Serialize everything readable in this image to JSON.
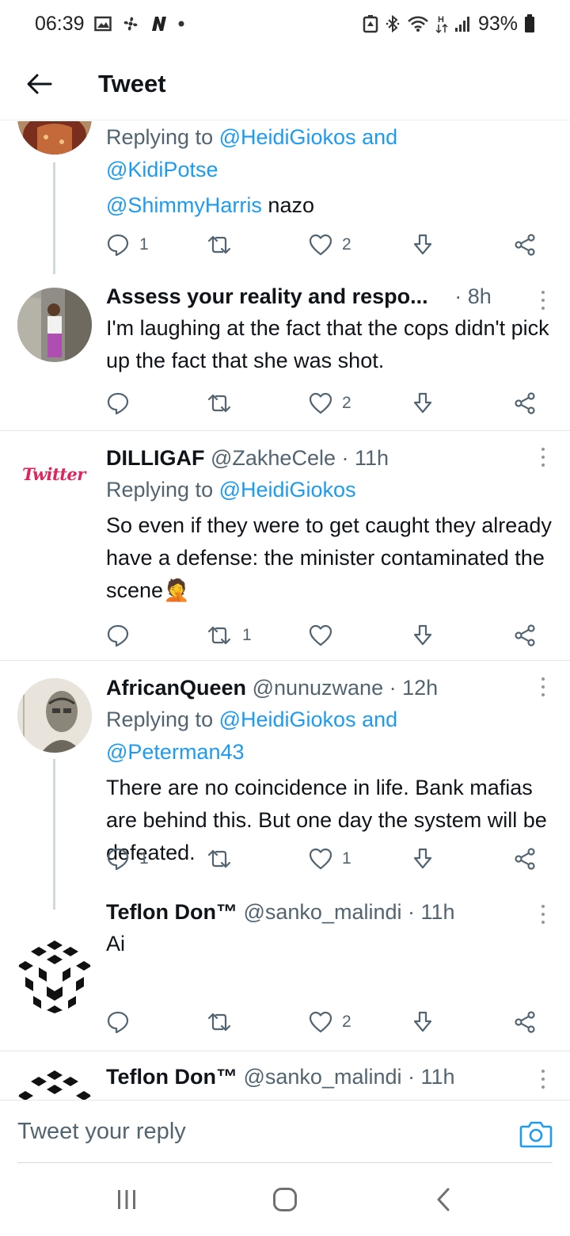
{
  "status_bar": {
    "time": "06:39",
    "battery": "93%",
    "left_icons": [
      "gallery-icon",
      "fan-icon",
      "n-app-icon",
      "dot-icon"
    ],
    "right_icons": [
      "battery-saver-icon",
      "bluetooth-icon",
      "wifi-icon",
      "h-data-icon",
      "signal-icon",
      "battery-icon"
    ]
  },
  "header": {
    "title": "Tweet",
    "back_icon": "arrow-left-icon"
  },
  "tweets": [
    {
      "reply_prefix": "Replying to",
      "reply_mentions": "@HeidiGiokos and @KidiPotse",
      "mention": "@ShimmyHarris",
      "text": " nazo",
      "reply_count": "1",
      "retweet_count": "",
      "like_count": "2"
    },
    {
      "name": "Assess your reality and respo...",
      "time": "· 8h",
      "text": "I'm laughing at the fact that the cops didn't pick up the fact that she was shot.",
      "reply_count": "",
      "retweet_count": "",
      "like_count": "2"
    },
    {
      "name": "DILLIGAF",
      "handle": "@ZakheCele",
      "time": "· 11h",
      "avatar_text": "Twitter",
      "reply_prefix": "Replying to",
      "reply_mentions": "@HeidiGiokos",
      "text": "So even if they were to get caught they already have a defense: the minister contaminated the scene",
      "emoji": "🤦",
      "reply_count": "",
      "retweet_count": "1",
      "like_count": ""
    },
    {
      "name": "AfricanQueen",
      "handle": "@nunuzwane",
      "time": "· 12h",
      "reply_prefix": "Replying to",
      "reply_mentions": "@HeidiGiokos and @Peterman43",
      "text": "There are no coincidence in life. Bank mafias are behind this. But one day the system will be defeated.",
      "reply_count": "1",
      "retweet_count": "",
      "like_count": "1"
    },
    {
      "name": "Teflon Don™",
      "handle": "@sanko_malindi",
      "time": "· 11h",
      "text": "Ai",
      "reply_count": "",
      "retweet_count": "",
      "like_count": "2"
    },
    {
      "name": "Teflon Don™",
      "handle": "@sanko_malindi",
      "time": "· 11h"
    }
  ],
  "reply_bar": {
    "placeholder": "Tweet your reply",
    "camera_icon": "camera-icon"
  },
  "nav_bar": {
    "icons": [
      "recents-icon",
      "home-icon",
      "back-icon"
    ]
  },
  "colors": {
    "accent": "#1d9bf0",
    "text": "#0f1419",
    "secondary": "#536471",
    "like": "#536471"
  }
}
